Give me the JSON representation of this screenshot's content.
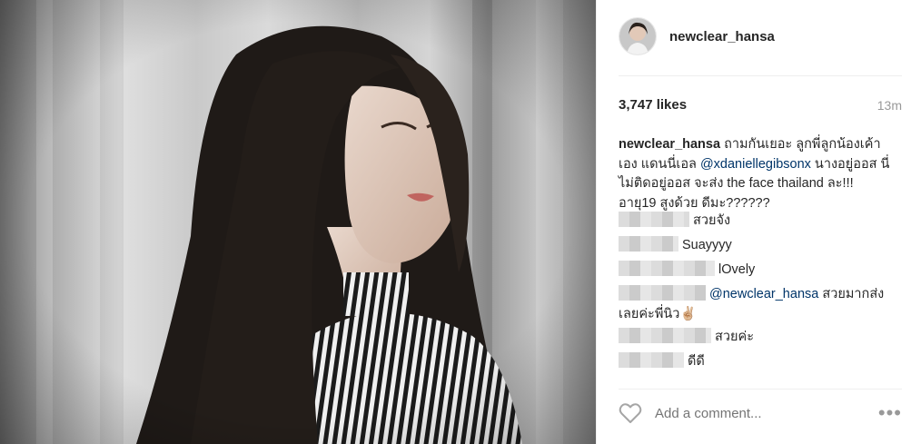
{
  "post": {
    "username": "newclear_hansa",
    "likes": "3,747 likes",
    "time": "13m",
    "caption": {
      "username": "newclear_hansa",
      "text_before": " ถามกันเยอะ ลูกพี่ลูกน้องเค้าเอง แดนนี่เอล ",
      "mention": "@xdaniellegibsonx",
      "text_after": " นางอยู่ออส นี่ไม่ติดอยู่ออส จะส่ง the face thailand ละ!!! อายุ19 สูงด้วย ดีมะ??????"
    },
    "comments": [
      {
        "text": "สวยจัง"
      },
      {
        "text": "Suayyyy"
      },
      {
        "text": "lOvely"
      },
      {
        "mention": "@newclear_hansa",
        "text": " สวยมากส่งเลยค่ะพี่นิว✌🏼"
      },
      {
        "text": "สวยค่ะ"
      },
      {
        "text": "ดีดี"
      }
    ],
    "add_comment_placeholder": "Add a comment...",
    "more_label": "•••"
  },
  "icons": {
    "like": "heart-icon",
    "more": "more-options-icon",
    "avatar": "avatar"
  }
}
